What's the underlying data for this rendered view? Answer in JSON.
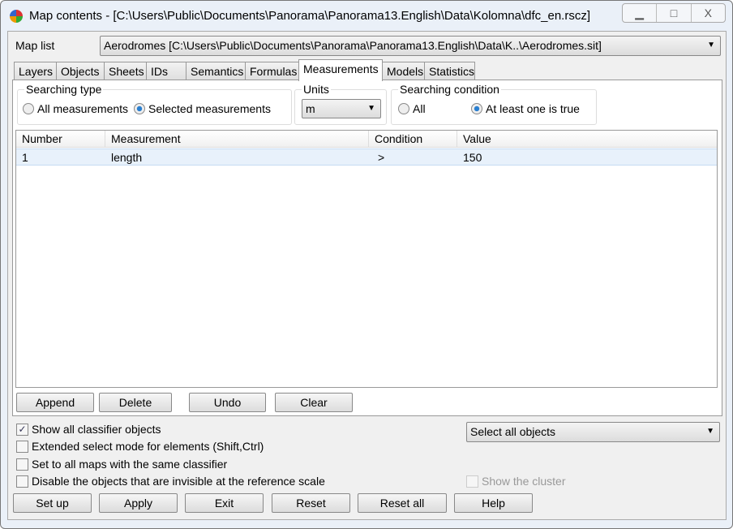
{
  "window": {
    "title": "Map contents - [C:\\Users\\Public\\Documents\\Panorama\\Panorama13.English\\Data\\Kolomna\\dfc_en.rscz]",
    "minimize": "▁",
    "maximize": "□",
    "close": "X"
  },
  "map_list": {
    "label": "Map list",
    "value": "Aerodromes [C:\\Users\\Public\\Documents\\Panorama\\Panorama13.English\\Data\\K..\\Aerodromes.sit]"
  },
  "tabs": [
    {
      "label": "Layers"
    },
    {
      "label": "Objects"
    },
    {
      "label": "Sheets"
    },
    {
      "label": "IDs"
    },
    {
      "label": "Semantics"
    },
    {
      "label": "Formulas"
    },
    {
      "label": "Measurements",
      "active": true
    },
    {
      "label": "Models"
    },
    {
      "label": "Statistics"
    }
  ],
  "searching_type": {
    "label": "Searching type",
    "options": [
      "All measurements",
      "Selected measurements"
    ],
    "selected": "Selected measurements"
  },
  "units": {
    "label": "Units",
    "value": "m"
  },
  "searching_condition": {
    "label": "Searching condition",
    "options": [
      "All",
      "At least one is true"
    ],
    "selected": "At least one is true"
  },
  "table": {
    "columns": [
      "Number",
      "Measurement",
      "Condition",
      "Value"
    ],
    "rows": [
      [
        "1",
        "length",
        ">",
        "150"
      ]
    ]
  },
  "table_buttons": [
    "Append",
    "Delete",
    "Undo",
    "Clear"
  ],
  "checkboxes": [
    {
      "label": "Show all classifier objects",
      "checked": true
    },
    {
      "label": "Extended select mode for elements (Shift,Ctrl)",
      "checked": false
    },
    {
      "label": "Set to all maps with the same classifier",
      "checked": false
    },
    {
      "label": "Disable the objects that are invisible at the reference scale",
      "checked": false
    }
  ],
  "select_combo": {
    "value": "Select all objects"
  },
  "show_cluster": {
    "label": "Show the cluster",
    "checked": false,
    "disabled": true
  },
  "bottom_buttons": [
    "Set up",
    "Apply",
    "Exit",
    "Reset",
    "Reset all",
    "Help"
  ]
}
